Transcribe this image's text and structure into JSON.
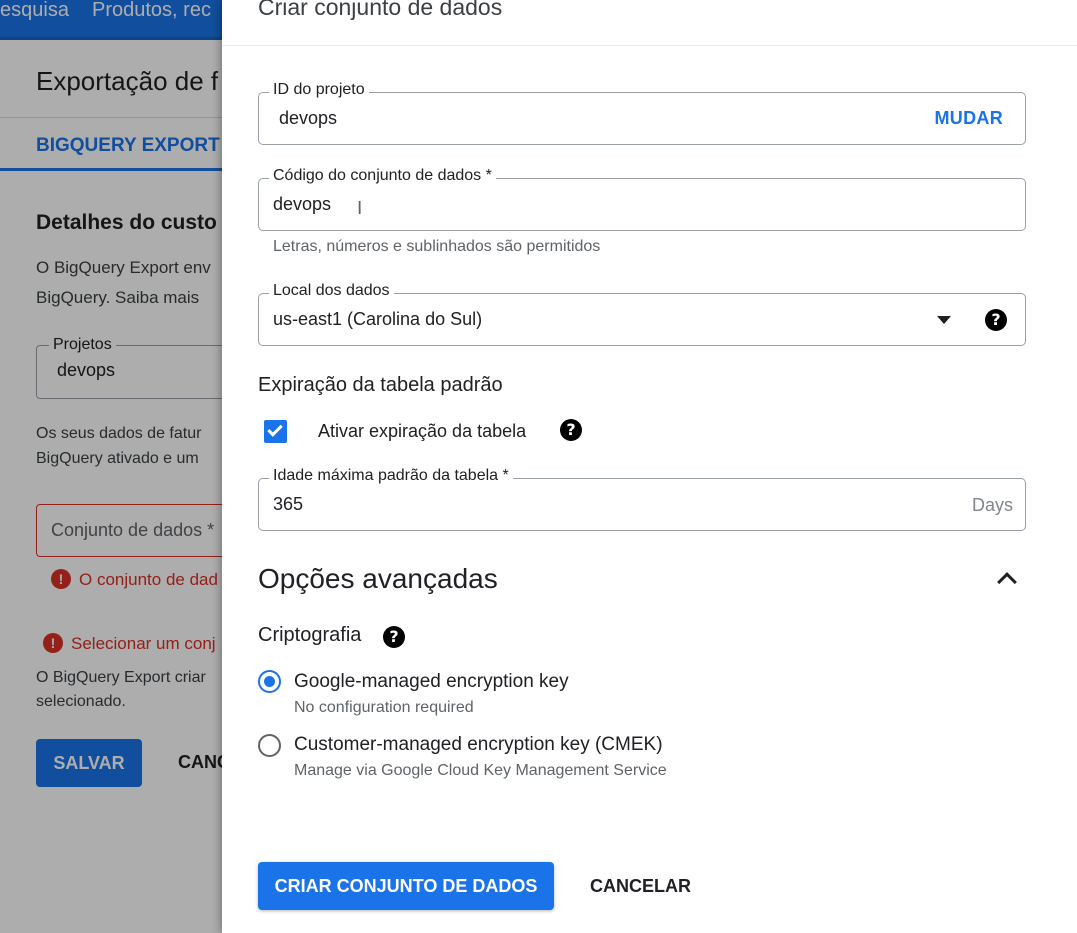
{
  "background": {
    "topbar": {
      "left_text": "esquisa",
      "products_text": "Produtos, rec"
    },
    "title": "Exportação de f",
    "tab": "BIGQUERY EXPORT",
    "details_heading": "Detalhes do custo",
    "desc_line1": "O BigQuery Export env",
    "desc_line2": "BigQuery. Saiba mais",
    "projects_label": "Projetos",
    "projects_value": "devops",
    "info_line1": "Os seus dados de fatur",
    "info_line2": "BigQuery ativado e um",
    "dataset_placeholder": "Conjunto de dados *",
    "dataset_error": "O conjunto de dad",
    "select_error": "Selecionar um conj",
    "export_line1": "O BigQuery Export criar",
    "export_line2": "selecionado.",
    "save_label": "SALVAR",
    "cancel_label": "CANC"
  },
  "dialog": {
    "title": "Criar conjunto de dados",
    "project_id": {
      "label": "ID do projeto",
      "value": "devops",
      "action": "MUDAR"
    },
    "dataset_code": {
      "label": "Código do conjunto de dados *",
      "value": "devops",
      "hint": "Letras, números e sublinhados são permitidos"
    },
    "data_location": {
      "label": "Local dos dados",
      "value": "us-east1 (Carolina do Sul)"
    },
    "expiration": {
      "heading": "Expiração da tabela padrão",
      "checkbox_label": "Ativar expiração da tabela",
      "checked": true,
      "max_age_label": "Idade máxima padrão da tabela *",
      "max_age_value": "365",
      "unit": "Days"
    },
    "advanced": {
      "title": "Opções avançadas",
      "encryption_heading": "Criptografia",
      "options": [
        {
          "label": "Google-managed encryption key",
          "sub": "No configuration required",
          "selected": true
        },
        {
          "label": "Customer-managed encryption key (CMEK)",
          "sub": "Manage via Google Cloud Key Management Service",
          "selected": false
        }
      ]
    },
    "create_label": "CRIAR CONJUNTO DE DADOS",
    "cancel_label": "CANCELAR"
  },
  "colors": {
    "accent": "#1a73e8",
    "error": "#d93025",
    "text": "#202124",
    "muted": "#5f6368"
  },
  "icons": [
    "help-icon",
    "dropdown-arrow-icon",
    "chevron-up-icon",
    "check-icon",
    "error-icon"
  ]
}
